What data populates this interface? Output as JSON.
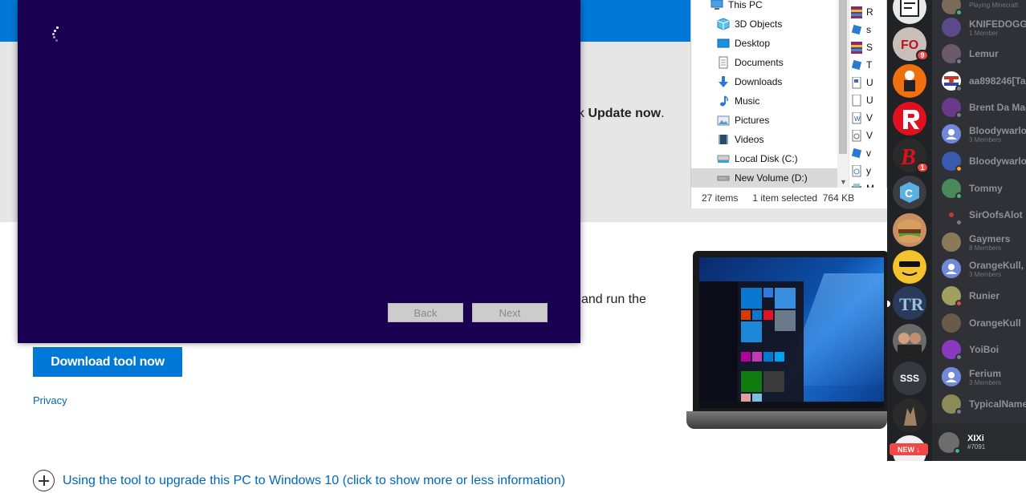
{
  "ms_page": {
    "update_prefix": "ck ",
    "update_bold": "Update now",
    "update_suffix": ".",
    "run_text": "and run the",
    "download_button": "Download tool now",
    "privacy_link": "Privacy",
    "expand_link": "Using the tool to upgrade this PC to Windows 10 (click to show more or less information)",
    "accent_color": "#0078d7"
  },
  "setup_dialog": {
    "background_color": "#1a0050",
    "back_button": "Back",
    "next_button": "Next"
  },
  "explorer": {
    "nav_items": [
      {
        "label": "This PC",
        "icon": "computer-icon"
      },
      {
        "label": "3D Objects",
        "icon": "cube-icon"
      },
      {
        "label": "Desktop",
        "icon": "desktop-icon"
      },
      {
        "label": "Documents",
        "icon": "document-icon"
      },
      {
        "label": "Downloads",
        "icon": "download-icon"
      },
      {
        "label": "Music",
        "icon": "music-icon"
      },
      {
        "label": "Pictures",
        "icon": "pictures-icon"
      },
      {
        "label": "Videos",
        "icon": "videos-icon"
      },
      {
        "label": "Local Disk (C:)",
        "icon": "drive-icon"
      },
      {
        "label": "New Volume (D:)",
        "icon": "drive-icon"
      }
    ],
    "selected_nav": "New Volume (D:)",
    "file_rows": [
      "R",
      "s",
      "S",
      "T",
      "U",
      "U",
      "V",
      "V",
      "v",
      "y",
      "M"
    ],
    "status_count": "27 items",
    "status_selected": "1 item selected",
    "status_size": "764 KB"
  },
  "discord": {
    "guild_badges": [
      "9",
      "1"
    ],
    "guild_text": "SSS",
    "new_badge": "NEW",
    "dms": [
      {
        "name": "",
        "sub": "Playing Minecraft",
        "color": "#7a6a5a"
      },
      {
        "name": "KNIFEDOGG",
        "sub": "1 Member",
        "color": "#5a4a8a"
      },
      {
        "name": "Lemur",
        "sub": "",
        "color": "#6a5a6a"
      },
      {
        "name": "aa898246[Ta",
        "sub": "",
        "color": "#c0392b"
      },
      {
        "name": "Brent Da Mag",
        "sub": "",
        "color": "#6a3a8a"
      },
      {
        "name": "Bloodywarlord",
        "sub": "3 Members",
        "color": "#7289da"
      },
      {
        "name": "Bloodywarlord",
        "sub": "",
        "color": "#3a5ab0"
      },
      {
        "name": "Tommy",
        "sub": "",
        "color": "#4a8a5a"
      },
      {
        "name": "SirOofsAlot",
        "sub": "",
        "color": "#2f3136"
      },
      {
        "name": "Gaymers",
        "sub": "8 Members",
        "color": "#8a7a5a"
      },
      {
        "name": "OrangeKull, xX",
        "sub": "3 Members",
        "color": "#7289da"
      },
      {
        "name": "Runier",
        "sub": "",
        "color": "#a0a060"
      },
      {
        "name": "OrangeKull",
        "sub": "",
        "color": "#6a5a4a"
      },
      {
        "name": "YoiBoi",
        "sub": "",
        "color": "#8a3ac0"
      },
      {
        "name": "Ferium",
        "sub": "3 Members",
        "color": "#7289da"
      },
      {
        "name": "TypicalName",
        "sub": "",
        "color": "#8a8a5a"
      }
    ],
    "user_name": "XIXi",
    "user_tag": "#7091"
  }
}
